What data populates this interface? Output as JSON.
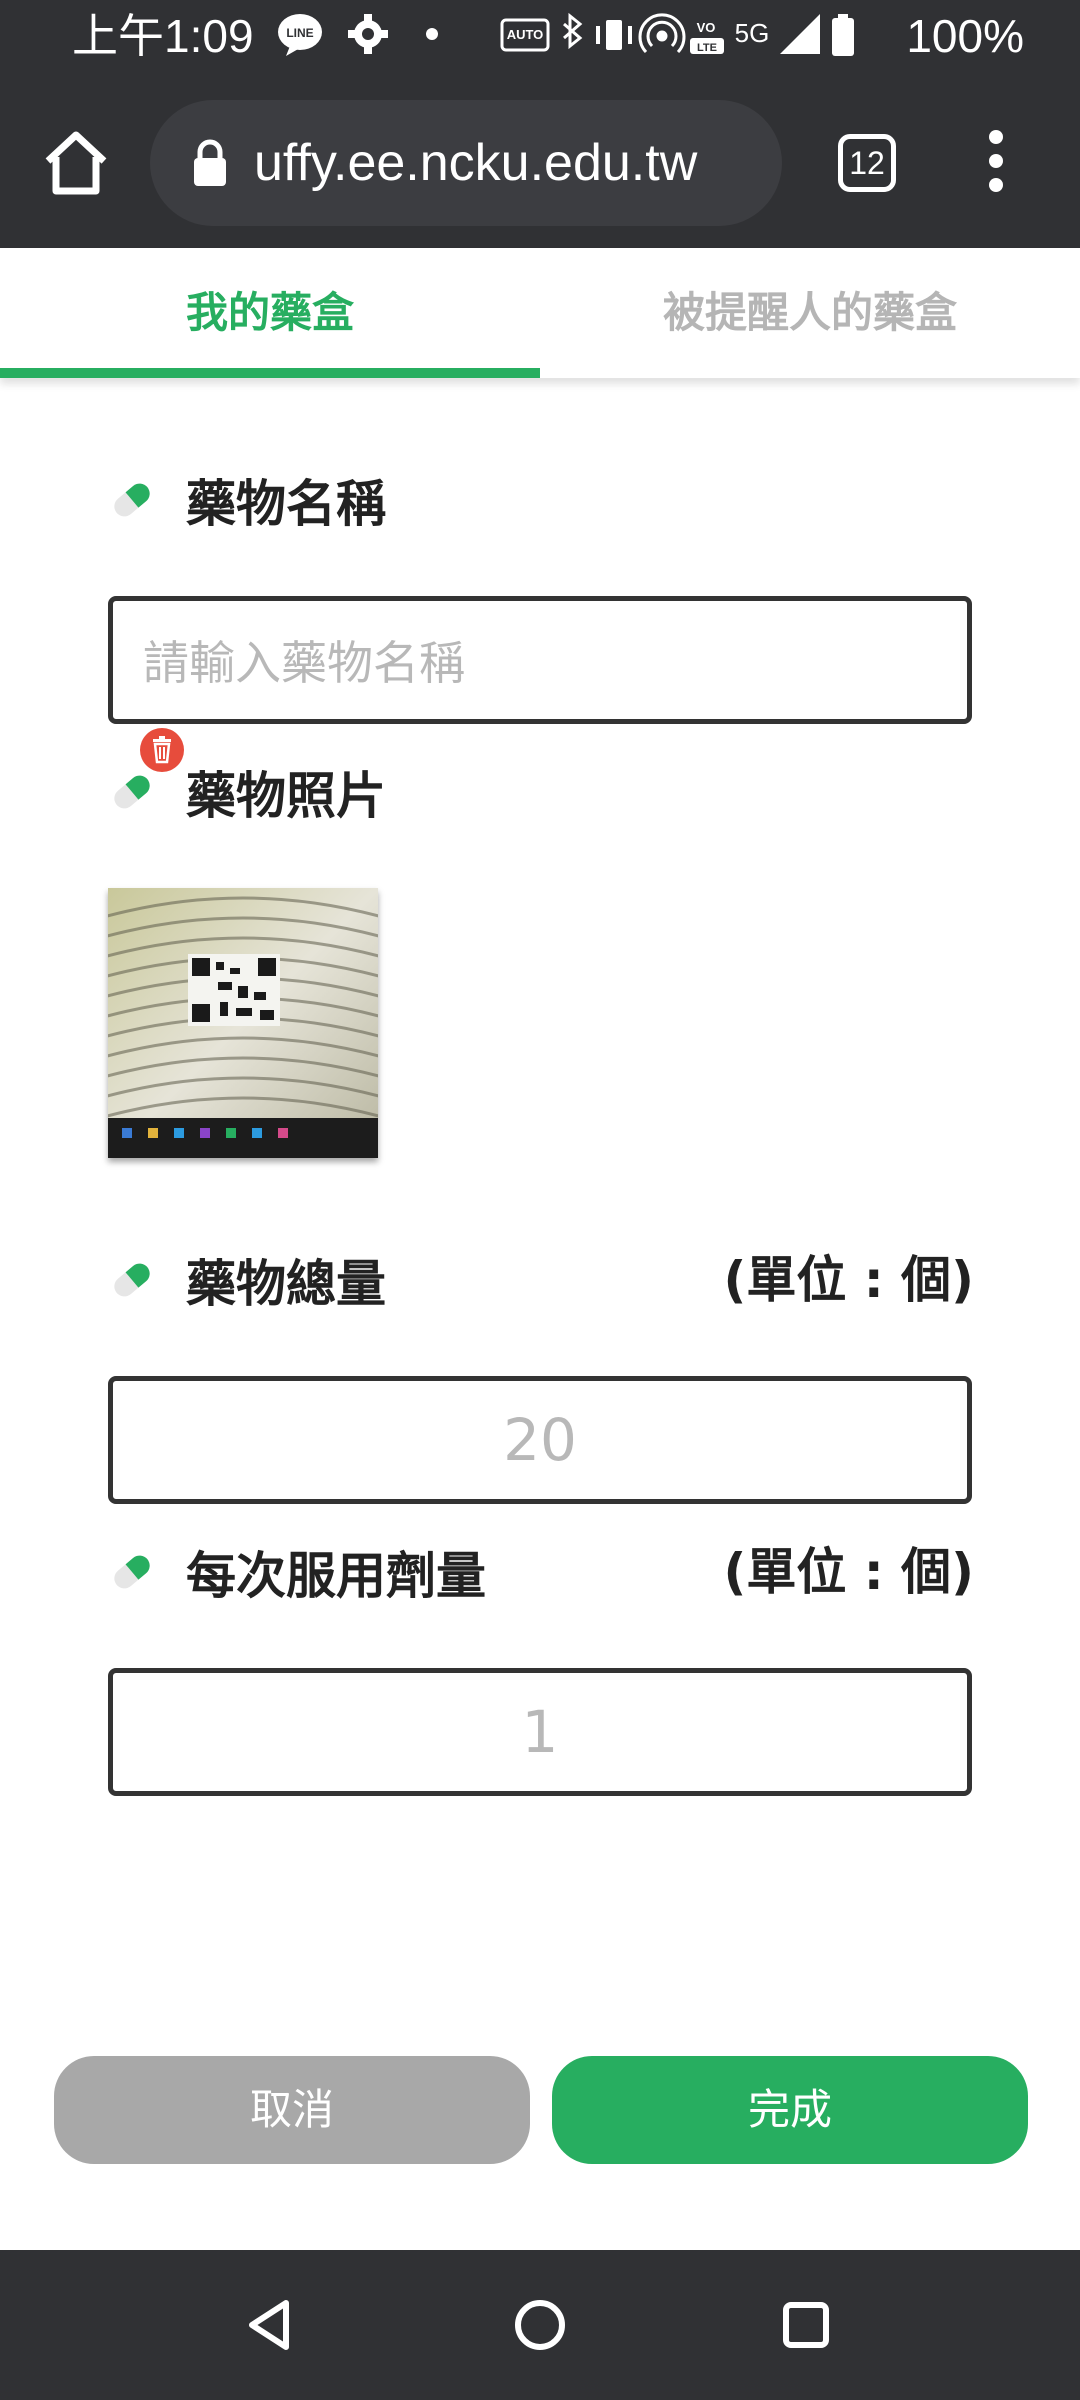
{
  "status_bar": {
    "time": "上午1:09",
    "battery": "100%",
    "icons": [
      "line-icon",
      "settings-icon",
      "dot-icon",
      "auto-hz-icon",
      "bluetooth-icon",
      "vibrate-icon",
      "hotspot-icon",
      "volte-icon",
      "5g-icon",
      "signal-icon",
      "battery-icon"
    ]
  },
  "browser": {
    "url": "uffy.ee.ncku.edu.tw",
    "tab_count": "12"
  },
  "tabs": [
    {
      "label": "我的藥盒",
      "active": true
    },
    {
      "label": "被提醒人的藥盒",
      "active": false
    }
  ],
  "form": {
    "name_label": "藥物名稱",
    "name_placeholder": "請輸入藥物名稱",
    "photo_label": "藥物照片",
    "total_label": "藥物總量",
    "total_unit": "(單位 : 個)",
    "total_placeholder": "20",
    "dose_label": "每次服用劑量",
    "dose_unit": "(單位 : 個)",
    "dose_placeholder": "1"
  },
  "buttons": {
    "cancel": "取消",
    "done": "完成"
  },
  "colors": {
    "accent": "#27ae60",
    "cancel": "#a8a8a8",
    "delete": "#e74c3c",
    "chrome": "#303134"
  }
}
